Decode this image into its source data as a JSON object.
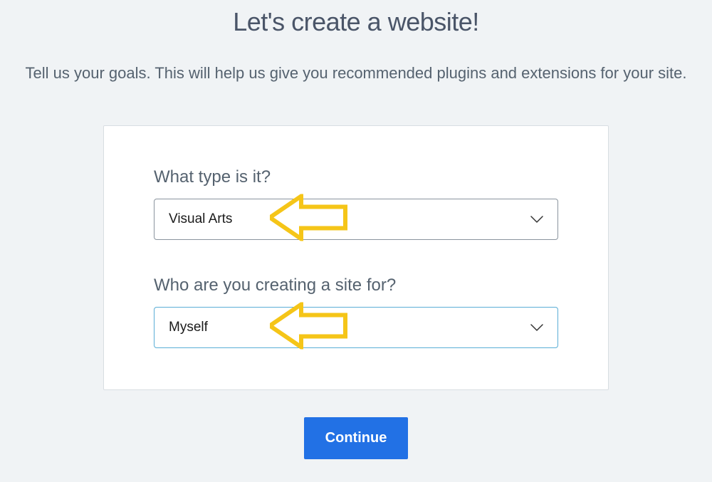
{
  "header": {
    "title": "Let's create a website!",
    "subtitle": "Tell us your goals. This will help us give you recommended plugins and extensions for your site."
  },
  "form": {
    "fields": [
      {
        "label": "What type is it?",
        "value": "Visual Arts"
      },
      {
        "label": "Who are you creating a site for?",
        "value": "Myself"
      }
    ]
  },
  "actions": {
    "continue_label": "Continue"
  },
  "annotations": {
    "arrow_color": "#f5c518"
  }
}
